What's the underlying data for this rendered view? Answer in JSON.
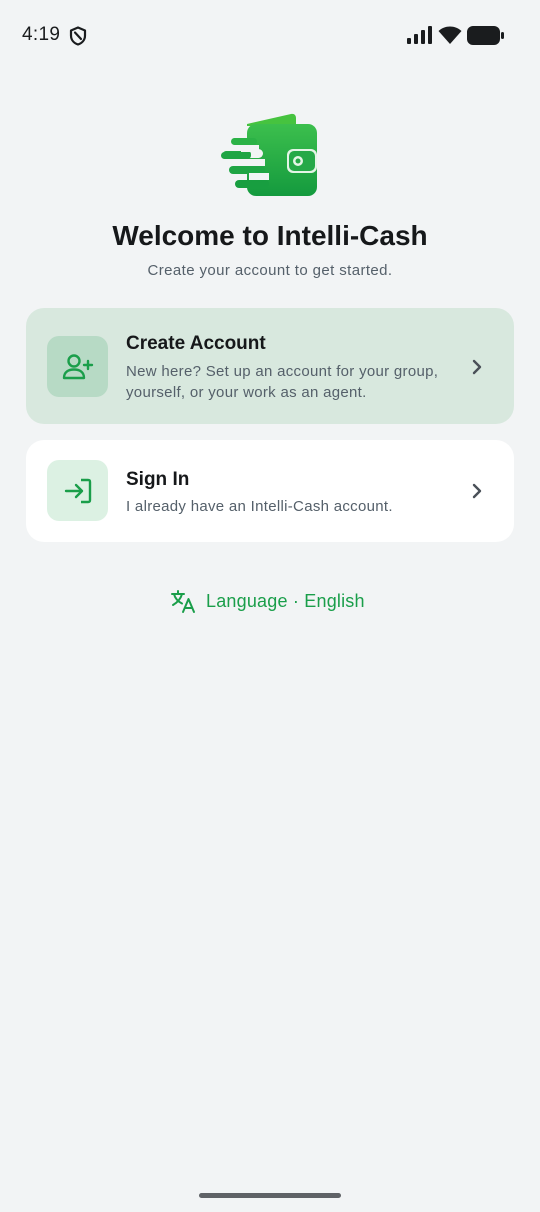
{
  "status_bar": {
    "time": "4:19"
  },
  "header": {
    "title": "Welcome to Intelli-Cash",
    "subtitle": "Create your account to get started."
  },
  "options": {
    "create_account": {
      "title": "Create Account",
      "description": "New here? Set up an account for your group, yourself, or your work as an agent.",
      "icon": "person-add-icon"
    },
    "sign_in": {
      "title": "Sign In",
      "description": "I already have an Intelli-Cash account.",
      "icon": "login-icon"
    }
  },
  "language": {
    "label": "Language · English",
    "icon": "translate-icon"
  },
  "colors": {
    "brand_green": "#1a9e4a",
    "background": "#f2f4f5",
    "create_card_bg": "#d8e8de",
    "signin_card_bg": "#ffffff"
  }
}
